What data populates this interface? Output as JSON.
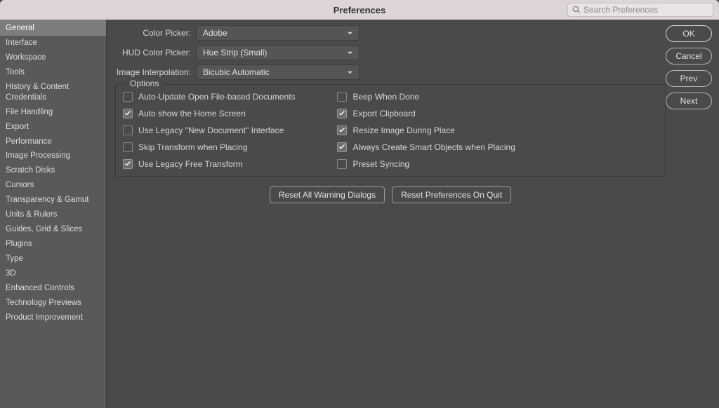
{
  "window": {
    "title": "Preferences",
    "search_placeholder": "Search Preferences"
  },
  "sidebar": {
    "items": [
      "General",
      "Interface",
      "Workspace",
      "Tools",
      "History & Content Credentials",
      "File Handling",
      "Export",
      "Performance",
      "Image Processing",
      "Scratch Disks",
      "Cursors",
      "Transparency & Gamut",
      "Units & Rulers",
      "Guides, Grid & Slices",
      "Plugins",
      "Type",
      "3D",
      "Enhanced Controls",
      "Technology Previews",
      "Product Improvement"
    ],
    "selected_index": 0
  },
  "buttons": {
    "ok": "OK",
    "cancel": "Cancel",
    "prev": "Prev",
    "next": "Next",
    "reset_warnings": "Reset All Warning Dialogs",
    "reset_on_quit": "Reset Preferences On Quit"
  },
  "form": {
    "color_picker": {
      "label": "Color Picker:",
      "value": "Adobe"
    },
    "hud_color_picker": {
      "label": "HUD Color Picker:",
      "value": "Hue Strip (Small)"
    },
    "image_interpolation": {
      "label": "Image Interpolation:",
      "value": "Bicubic Automatic"
    }
  },
  "options": {
    "legend": "Options",
    "col1": [
      {
        "label": "Auto-Update Open File-based Documents",
        "checked": false
      },
      {
        "label": "Auto show the Home Screen",
        "checked": true
      },
      {
        "label": "Use Legacy \"New Document\" Interface",
        "checked": false
      },
      {
        "label": "Skip Transform when Placing",
        "checked": false
      },
      {
        "label": "Use Legacy Free Transform",
        "checked": true
      }
    ],
    "col2": [
      {
        "label": "Beep When Done",
        "checked": false
      },
      {
        "label": "Export Clipboard",
        "checked": true
      },
      {
        "label": "Resize Image During Place",
        "checked": true
      },
      {
        "label": "Always Create Smart Objects when Placing",
        "checked": true
      },
      {
        "label": "Preset Syncing",
        "checked": false
      }
    ]
  }
}
